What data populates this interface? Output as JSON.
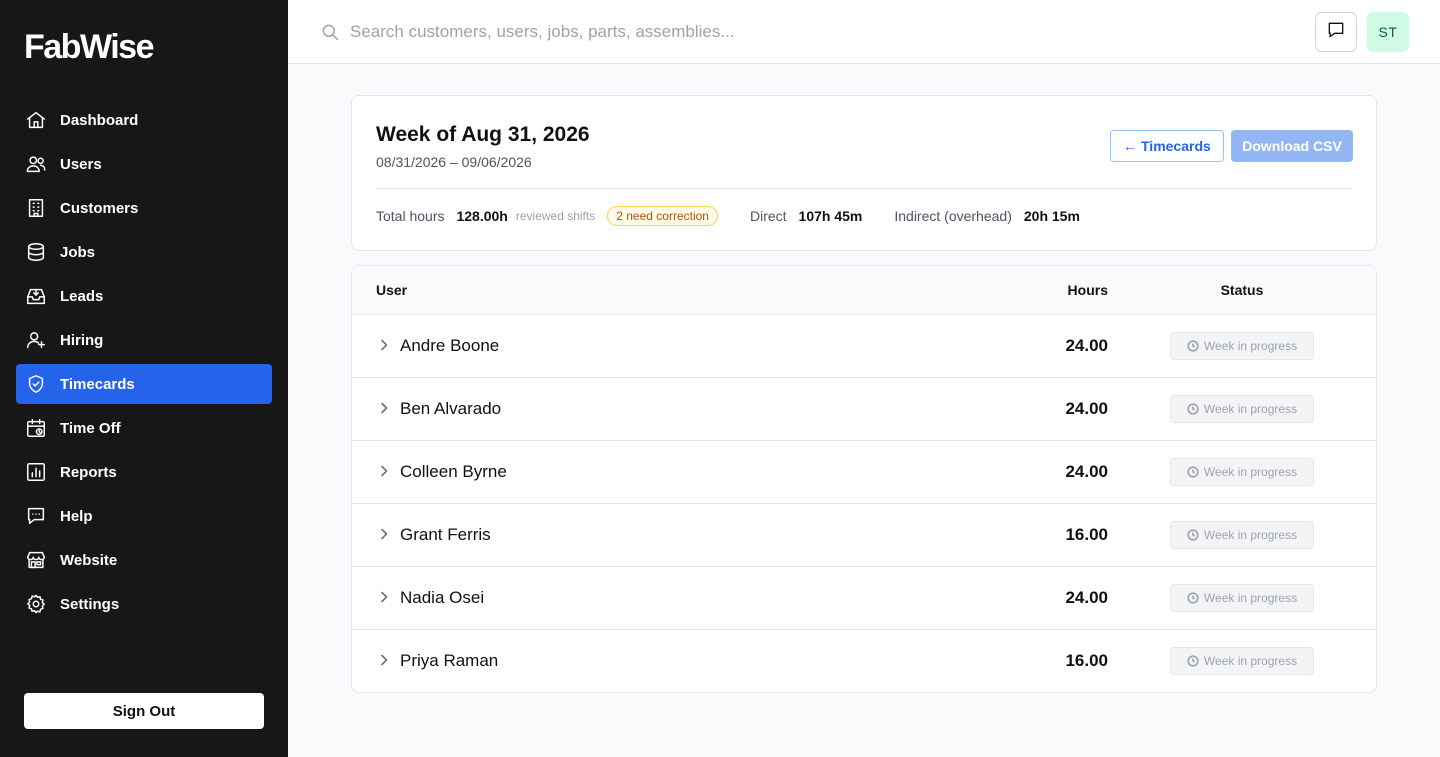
{
  "app": {
    "brand": "FabWise"
  },
  "sidebar": {
    "items": [
      {
        "label": "Dashboard",
        "icon": "home-icon",
        "active": false
      },
      {
        "label": "Users",
        "icon": "users-icon",
        "active": false
      },
      {
        "label": "Customers",
        "icon": "building-icon",
        "active": false
      },
      {
        "label": "Jobs",
        "icon": "database-icon",
        "active": false
      },
      {
        "label": "Leads",
        "icon": "inbox-icon",
        "active": false
      },
      {
        "label": "Hiring",
        "icon": "user-plus-icon",
        "active": false
      },
      {
        "label": "Timecards",
        "icon": "shield-check-icon",
        "active": true
      },
      {
        "label": "Time Off",
        "icon": "calendar-clock-icon",
        "active": false
      },
      {
        "label": "Reports",
        "icon": "bar-chart-icon",
        "active": false
      },
      {
        "label": "Help",
        "icon": "chat-bubble-icon",
        "active": false
      },
      {
        "label": "Website",
        "icon": "storefront-icon",
        "active": false
      },
      {
        "label": "Settings",
        "icon": "gear-icon",
        "active": false
      }
    ],
    "signout_label": "Sign Out"
  },
  "topbar": {
    "search_placeholder": "Search customers, users, jobs, parts, assemblies...",
    "avatar_initials": "ST"
  },
  "header": {
    "title": "Week of Aug 31, 2026",
    "range": "08/31/2026 – 09/06/2026",
    "back_label": "Timecards",
    "csv_label": "Download CSV",
    "total_hours_label": "Total hours",
    "total_hours_value": "128.00h",
    "reviewed_note": "reviewed shifts",
    "correction_badge": "2 need correction",
    "direct_label": "Direct",
    "direct_value": "107h 45m",
    "indirect_label": "Indirect (overhead)",
    "indirect_value": "20h 15m"
  },
  "table": {
    "columns": {
      "user": "User",
      "hours": "Hours",
      "status": "Status"
    },
    "rows": [
      {
        "name": "Andre Boone",
        "hours": "24.00",
        "status": "Week in progress"
      },
      {
        "name": "Ben Alvarado",
        "hours": "24.00",
        "status": "Week in progress"
      },
      {
        "name": "Colleen Byrne",
        "hours": "24.00",
        "status": "Week in progress"
      },
      {
        "name": "Grant Ferris",
        "hours": "16.00",
        "status": "Week in progress"
      },
      {
        "name": "Nadia Osei",
        "hours": "24.00",
        "status": "Week in progress"
      },
      {
        "name": "Priya Raman",
        "hours": "16.00",
        "status": "Week in progress"
      }
    ]
  },
  "colors": {
    "sidebar_bg": "#171717",
    "accent": "#2563eb",
    "csv_disabled": "#93b7f5",
    "warning": "#b45309",
    "avatar_bg": "#d1fae5"
  }
}
